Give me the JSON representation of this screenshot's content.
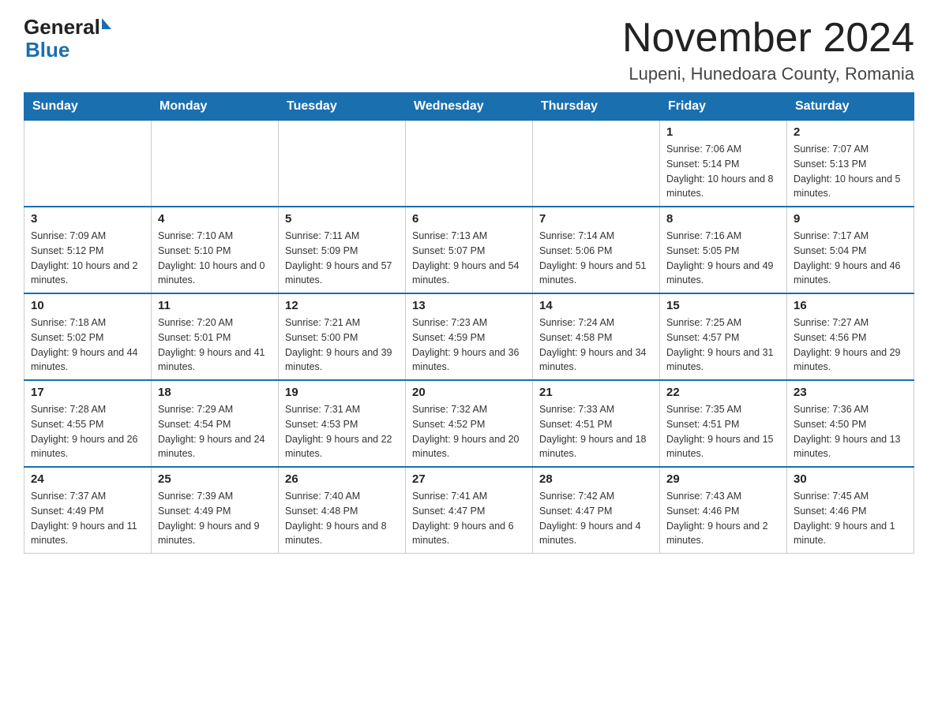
{
  "header": {
    "logo_text_general": "General",
    "logo_text_blue": "Blue",
    "month_year": "November 2024",
    "location": "Lupeni, Hunedoara County, Romania"
  },
  "days_of_week": [
    "Sunday",
    "Monday",
    "Tuesday",
    "Wednesday",
    "Thursday",
    "Friday",
    "Saturday"
  ],
  "weeks": [
    [
      {
        "day": "",
        "info": ""
      },
      {
        "day": "",
        "info": ""
      },
      {
        "day": "",
        "info": ""
      },
      {
        "day": "",
        "info": ""
      },
      {
        "day": "",
        "info": ""
      },
      {
        "day": "1",
        "info": "Sunrise: 7:06 AM\nSunset: 5:14 PM\nDaylight: 10 hours and 8 minutes."
      },
      {
        "day": "2",
        "info": "Sunrise: 7:07 AM\nSunset: 5:13 PM\nDaylight: 10 hours and 5 minutes."
      }
    ],
    [
      {
        "day": "3",
        "info": "Sunrise: 7:09 AM\nSunset: 5:12 PM\nDaylight: 10 hours and 2 minutes."
      },
      {
        "day": "4",
        "info": "Sunrise: 7:10 AM\nSunset: 5:10 PM\nDaylight: 10 hours and 0 minutes."
      },
      {
        "day": "5",
        "info": "Sunrise: 7:11 AM\nSunset: 5:09 PM\nDaylight: 9 hours and 57 minutes."
      },
      {
        "day": "6",
        "info": "Sunrise: 7:13 AM\nSunset: 5:07 PM\nDaylight: 9 hours and 54 minutes."
      },
      {
        "day": "7",
        "info": "Sunrise: 7:14 AM\nSunset: 5:06 PM\nDaylight: 9 hours and 51 minutes."
      },
      {
        "day": "8",
        "info": "Sunrise: 7:16 AM\nSunset: 5:05 PM\nDaylight: 9 hours and 49 minutes."
      },
      {
        "day": "9",
        "info": "Sunrise: 7:17 AM\nSunset: 5:04 PM\nDaylight: 9 hours and 46 minutes."
      }
    ],
    [
      {
        "day": "10",
        "info": "Sunrise: 7:18 AM\nSunset: 5:02 PM\nDaylight: 9 hours and 44 minutes."
      },
      {
        "day": "11",
        "info": "Sunrise: 7:20 AM\nSunset: 5:01 PM\nDaylight: 9 hours and 41 minutes."
      },
      {
        "day": "12",
        "info": "Sunrise: 7:21 AM\nSunset: 5:00 PM\nDaylight: 9 hours and 39 minutes."
      },
      {
        "day": "13",
        "info": "Sunrise: 7:23 AM\nSunset: 4:59 PM\nDaylight: 9 hours and 36 minutes."
      },
      {
        "day": "14",
        "info": "Sunrise: 7:24 AM\nSunset: 4:58 PM\nDaylight: 9 hours and 34 minutes."
      },
      {
        "day": "15",
        "info": "Sunrise: 7:25 AM\nSunset: 4:57 PM\nDaylight: 9 hours and 31 minutes."
      },
      {
        "day": "16",
        "info": "Sunrise: 7:27 AM\nSunset: 4:56 PM\nDaylight: 9 hours and 29 minutes."
      }
    ],
    [
      {
        "day": "17",
        "info": "Sunrise: 7:28 AM\nSunset: 4:55 PM\nDaylight: 9 hours and 26 minutes."
      },
      {
        "day": "18",
        "info": "Sunrise: 7:29 AM\nSunset: 4:54 PM\nDaylight: 9 hours and 24 minutes."
      },
      {
        "day": "19",
        "info": "Sunrise: 7:31 AM\nSunset: 4:53 PM\nDaylight: 9 hours and 22 minutes."
      },
      {
        "day": "20",
        "info": "Sunrise: 7:32 AM\nSunset: 4:52 PM\nDaylight: 9 hours and 20 minutes."
      },
      {
        "day": "21",
        "info": "Sunrise: 7:33 AM\nSunset: 4:51 PM\nDaylight: 9 hours and 18 minutes."
      },
      {
        "day": "22",
        "info": "Sunrise: 7:35 AM\nSunset: 4:51 PM\nDaylight: 9 hours and 15 minutes."
      },
      {
        "day": "23",
        "info": "Sunrise: 7:36 AM\nSunset: 4:50 PM\nDaylight: 9 hours and 13 minutes."
      }
    ],
    [
      {
        "day": "24",
        "info": "Sunrise: 7:37 AM\nSunset: 4:49 PM\nDaylight: 9 hours and 11 minutes."
      },
      {
        "day": "25",
        "info": "Sunrise: 7:39 AM\nSunset: 4:49 PM\nDaylight: 9 hours and 9 minutes."
      },
      {
        "day": "26",
        "info": "Sunrise: 7:40 AM\nSunset: 4:48 PM\nDaylight: 9 hours and 8 minutes."
      },
      {
        "day": "27",
        "info": "Sunrise: 7:41 AM\nSunset: 4:47 PM\nDaylight: 9 hours and 6 minutes."
      },
      {
        "day": "28",
        "info": "Sunrise: 7:42 AM\nSunset: 4:47 PM\nDaylight: 9 hours and 4 minutes."
      },
      {
        "day": "29",
        "info": "Sunrise: 7:43 AM\nSunset: 4:46 PM\nDaylight: 9 hours and 2 minutes."
      },
      {
        "day": "30",
        "info": "Sunrise: 7:45 AM\nSunset: 4:46 PM\nDaylight: 9 hours and 1 minute."
      }
    ]
  ]
}
